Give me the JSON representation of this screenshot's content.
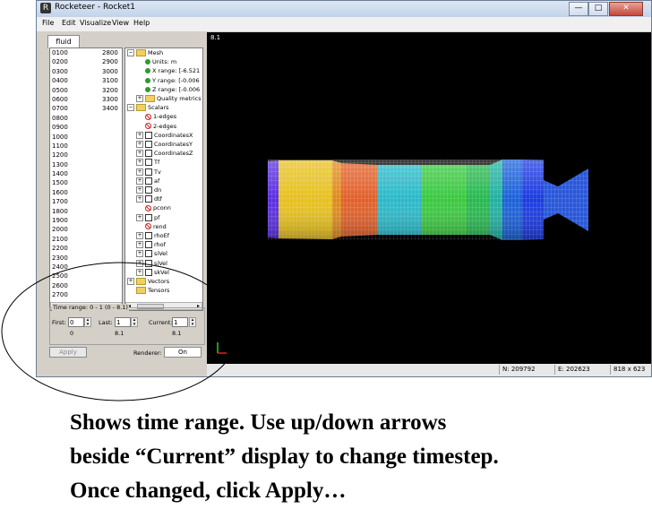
{
  "window": {
    "title": "Rocketeer - Rocket1",
    "min_label": "—",
    "max_label": "□",
    "close_label": "✕"
  },
  "menu": {
    "file": "File",
    "edit": "Edit",
    "visualize": "Visualize",
    "view": "View",
    "help": "Help"
  },
  "left": {
    "tab_label": "fluid",
    "list": [
      {
        "a": "0100",
        "b": "2800"
      },
      {
        "a": "0200",
        "b": "2900"
      },
      {
        "a": "0300",
        "b": "3000"
      },
      {
        "a": "0400",
        "b": "3100"
      },
      {
        "a": "0500",
        "b": "3200"
      },
      {
        "a": "0600",
        "b": "3300"
      },
      {
        "a": "0700",
        "b": "3400"
      },
      {
        "a": "0800",
        "b": ""
      },
      {
        "a": "0900",
        "b": ""
      },
      {
        "a": "1000",
        "b": ""
      },
      {
        "a": "1100",
        "b": ""
      },
      {
        "a": "1200",
        "b": ""
      },
      {
        "a": "1300",
        "b": ""
      },
      {
        "a": "1400",
        "b": ""
      },
      {
        "a": "1500",
        "b": ""
      },
      {
        "a": "1600",
        "b": ""
      },
      {
        "a": "1700",
        "b": ""
      },
      {
        "a": "1800",
        "b": ""
      },
      {
        "a": "1900",
        "b": ""
      },
      {
        "a": "2000",
        "b": ""
      },
      {
        "a": "2100",
        "b": ""
      },
      {
        "a": "2200",
        "b": ""
      },
      {
        "a": "2300",
        "b": ""
      },
      {
        "a": "2400",
        "b": ""
      },
      {
        "a": "2500",
        "b": ""
      },
      {
        "a": "2600",
        "b": ""
      },
      {
        "a": "2700",
        "b": ""
      }
    ],
    "tree": [
      {
        "label": "Mesh",
        "indent": 0,
        "icon": "folder",
        "expander": "−"
      },
      {
        "label": "Units: m",
        "indent": 1,
        "icon": "green-ball",
        "expander": ""
      },
      {
        "label": "X range: [-6.521",
        "indent": 1,
        "icon": "green-ball",
        "expander": ""
      },
      {
        "label": "Y range: [-0.006",
        "indent": 1,
        "icon": "green-ball",
        "expander": ""
      },
      {
        "label": "Z range: [-0.006",
        "indent": 1,
        "icon": "green-ball",
        "expander": ""
      },
      {
        "label": "Quality metrics",
        "indent": 1,
        "icon": "folder",
        "expander": "+"
      },
      {
        "label": "Scalars",
        "indent": 0,
        "icon": "folder",
        "expander": "−"
      },
      {
        "label": "1-edges",
        "indent": 1,
        "icon": "no",
        "expander": ""
      },
      {
        "label": "2-edges",
        "indent": 1,
        "icon": "no",
        "expander": ""
      },
      {
        "label": "CoordinatesX",
        "indent": 1,
        "icon": "check",
        "expander": "+"
      },
      {
        "label": "CoordinatesY",
        "indent": 1,
        "icon": "check",
        "expander": "+"
      },
      {
        "label": "CoordinatesZ",
        "indent": 1,
        "icon": "check",
        "expander": "+"
      },
      {
        "label": "Tf",
        "indent": 1,
        "icon": "check",
        "expander": "+"
      },
      {
        "label": "Tv",
        "indent": 1,
        "icon": "check",
        "expander": "+"
      },
      {
        "label": "af",
        "indent": 1,
        "icon": "check",
        "expander": "+"
      },
      {
        "label": "dn",
        "indent": 1,
        "icon": "check",
        "expander": "+"
      },
      {
        "label": "dtf",
        "indent": 1,
        "icon": "check",
        "expander": "+"
      },
      {
        "label": "pconn",
        "indent": 1,
        "icon": "no",
        "expander": ""
      },
      {
        "label": "pf",
        "indent": 1,
        "icon": "check",
        "expander": "+"
      },
      {
        "label": "rend",
        "indent": 1,
        "icon": "no",
        "expander": ""
      },
      {
        "label": "rhoEf",
        "indent": 1,
        "icon": "check",
        "expander": "+"
      },
      {
        "label": "rhof",
        "indent": 1,
        "icon": "check",
        "expander": "+"
      },
      {
        "label": "siVel",
        "indent": 1,
        "icon": "check",
        "expander": "+"
      },
      {
        "label": "sjVel",
        "indent": 1,
        "icon": "check",
        "expander": "+"
      },
      {
        "label": "skVel",
        "indent": 1,
        "icon": "check",
        "expander": "+"
      },
      {
        "label": "Vectors",
        "indent": 0,
        "icon": "folder",
        "expander": "+"
      },
      {
        "label": "Tensors",
        "indent": 0,
        "icon": "folder",
        "expander": ""
      }
    ],
    "time_range_label": "Time range: 0 - 1 (0 - 8.1)",
    "first_label": "First:",
    "first_value": "0",
    "first_sub": "0",
    "last_label": "Last:",
    "last_value": "1",
    "last_sub": "8.1",
    "current_label": "Current:",
    "current_value": "1",
    "current_sub": "8.1",
    "apply_label": "Apply",
    "renderer_label": "Renderer:",
    "renderer_value": "On"
  },
  "viewport": {
    "time_label": "8.1",
    "background": "#000000"
  },
  "status": {
    "n": "N: 209792",
    "e": "E: 202623",
    "size": "818 x 623"
  },
  "caption": {
    "line1": "Shows time range. Use up/down arrows",
    "line2": "beside “Current” display to change timestep.",
    "line3": "Once changed, click Apply…"
  }
}
